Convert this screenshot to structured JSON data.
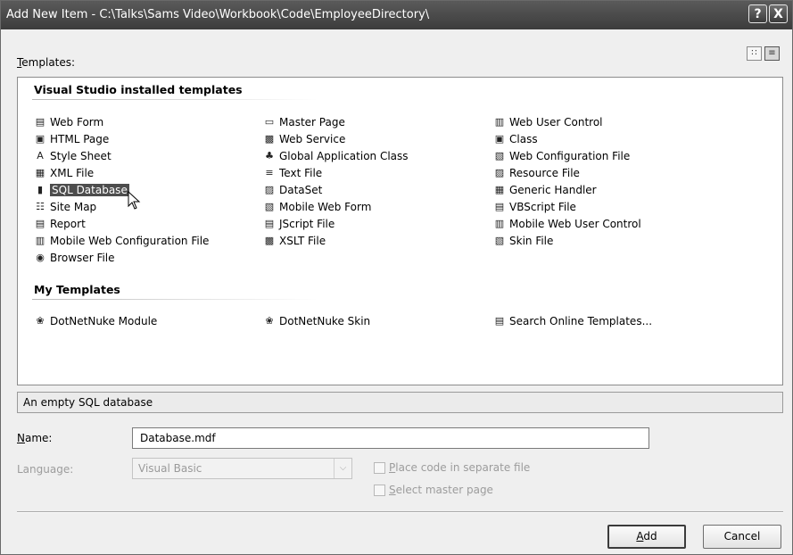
{
  "window": {
    "title": "Add New Item - C:\\Talks\\Sams Video\\Workbook\\Code\\EmployeeDirectory\\",
    "help_glyph": "?",
    "close_glyph": "X"
  },
  "templates_label": "Templates:",
  "templates_label_mnemonic": "T",
  "templates_label_rest": "emplates:",
  "view_toggle": {
    "large_icons": "large-icons-view-icon",
    "small_icons": "small-icons-view-icon"
  },
  "sections": {
    "installed": {
      "header": "Visual Studio installed templates",
      "columns": [
        [
          {
            "label": "Web Form",
            "icon": "web-form-icon"
          },
          {
            "label": "HTML Page",
            "icon": "html-page-icon"
          },
          {
            "label": "Style Sheet",
            "icon": "style-sheet-icon"
          },
          {
            "label": "XML File",
            "icon": "xml-file-icon"
          },
          {
            "label": "SQL Database",
            "icon": "sql-database-icon",
            "selected": true
          },
          {
            "label": "Site Map",
            "icon": "site-map-icon"
          },
          {
            "label": "Report",
            "icon": "report-icon"
          },
          {
            "label": "Mobile Web Configuration File",
            "icon": "mobile-web-config-icon"
          },
          {
            "label": "Browser File",
            "icon": "browser-file-icon"
          }
        ],
        [
          {
            "label": "Master Page",
            "icon": "master-page-icon"
          },
          {
            "label": "Web Service",
            "icon": "web-service-icon"
          },
          {
            "label": "Global Application Class",
            "icon": "global-application-class-icon"
          },
          {
            "label": "Text File",
            "icon": "text-file-icon"
          },
          {
            "label": "DataSet",
            "icon": "dataset-icon"
          },
          {
            "label": "Mobile Web Form",
            "icon": "mobile-web-form-icon"
          },
          {
            "label": "JScript File",
            "icon": "jscript-file-icon"
          },
          {
            "label": "XSLT File",
            "icon": "xslt-file-icon"
          }
        ],
        [
          {
            "label": "Web User Control",
            "icon": "web-user-control-icon"
          },
          {
            "label": "Class",
            "icon": "class-icon"
          },
          {
            "label": "Web Configuration File",
            "icon": "web-config-file-icon"
          },
          {
            "label": "Resource File",
            "icon": "resource-file-icon"
          },
          {
            "label": "Generic Handler",
            "icon": "generic-handler-icon"
          },
          {
            "label": "VBScript File",
            "icon": "vbscript-file-icon"
          },
          {
            "label": "Mobile Web User Control",
            "icon": "mobile-web-user-control-icon"
          },
          {
            "label": "Skin File",
            "icon": "skin-file-icon"
          }
        ]
      ]
    },
    "my": {
      "header": "My Templates",
      "items": [
        {
          "label": "DotNetNuke Module",
          "icon": "dotnetnuke-module-icon"
        },
        {
          "label": "DotNetNuke Skin",
          "icon": "dotnetnuke-skin-icon"
        },
        {
          "label": "Search Online Templates...",
          "icon": "search-online-templates-icon"
        }
      ]
    }
  },
  "description": "An empty SQL database",
  "name_field": {
    "label_mnemonic": "N",
    "label_rest": "ame:",
    "value": "Database.mdf"
  },
  "language_field": {
    "label": "Language:",
    "value": "Visual Basic"
  },
  "options": {
    "place_code": {
      "mnemonic": "P",
      "rest": "lace code in separate file",
      "checked": false
    },
    "master_page": {
      "mnemonic": "S",
      "rest": "elect master page",
      "checked": false
    }
  },
  "buttons": {
    "add": {
      "mnemonic": "A",
      "rest": "dd"
    },
    "cancel": "Cancel"
  }
}
